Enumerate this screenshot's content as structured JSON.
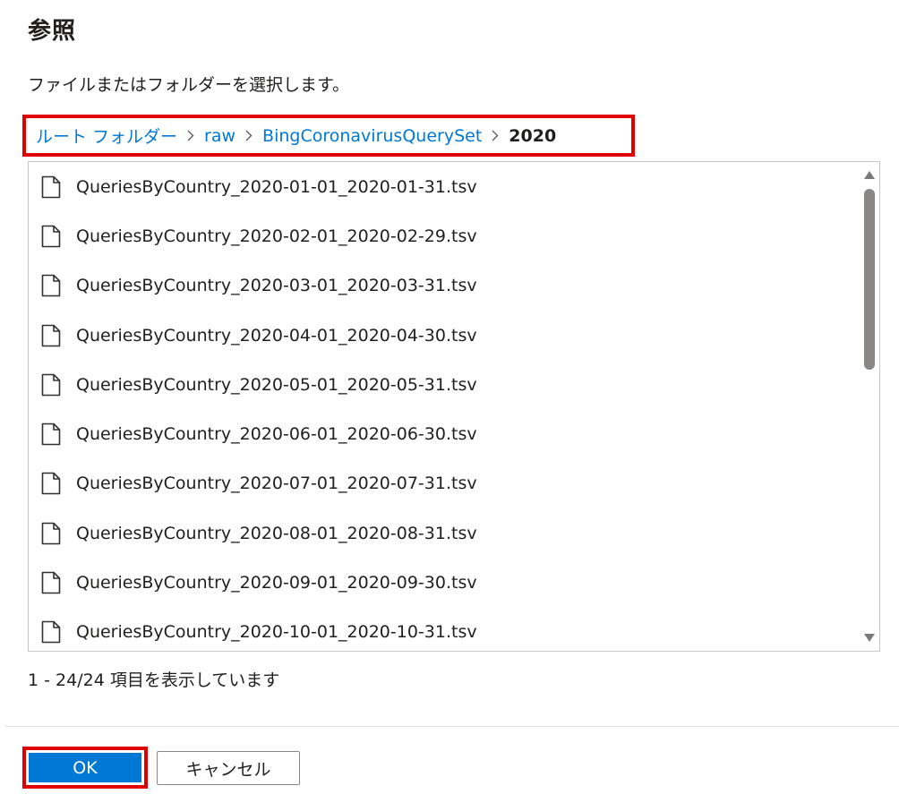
{
  "dialog": {
    "title": "参照",
    "description": "ファイルまたはフォルダーを選択します。"
  },
  "breadcrumb": {
    "items": [
      {
        "label": "ルート フォルダー",
        "link": true
      },
      {
        "label": "raw",
        "link": true
      },
      {
        "label": "BingCoronavirusQuerySet",
        "link": true
      },
      {
        "label": "2020",
        "link": false
      }
    ],
    "separator_icon": "chevron-right-icon"
  },
  "files": [
    {
      "name": "QueriesByCountry_2020-01-01_2020-01-31.tsv",
      "icon": "file-icon"
    },
    {
      "name": "QueriesByCountry_2020-02-01_2020-02-29.tsv",
      "icon": "file-icon"
    },
    {
      "name": "QueriesByCountry_2020-03-01_2020-03-31.tsv",
      "icon": "file-icon"
    },
    {
      "name": "QueriesByCountry_2020-04-01_2020-04-30.tsv",
      "icon": "file-icon"
    },
    {
      "name": "QueriesByCountry_2020-05-01_2020-05-31.tsv",
      "icon": "file-icon"
    },
    {
      "name": "QueriesByCountry_2020-06-01_2020-06-30.tsv",
      "icon": "file-icon"
    },
    {
      "name": "QueriesByCountry_2020-07-01_2020-07-31.tsv",
      "icon": "file-icon"
    },
    {
      "name": "QueriesByCountry_2020-08-01_2020-08-31.tsv",
      "icon": "file-icon"
    },
    {
      "name": "QueriesByCountry_2020-09-01_2020-09-30.tsv",
      "icon": "file-icon"
    },
    {
      "name": "QueriesByCountry_2020-10-01_2020-10-31.tsv",
      "icon": "file-icon"
    }
  ],
  "status": "1 - 24/24 項目を表示しています",
  "buttons": {
    "ok_label": "OK",
    "cancel_label": "キャンセル"
  },
  "colors": {
    "accent": "#0078d4",
    "highlight": "#e00000"
  }
}
